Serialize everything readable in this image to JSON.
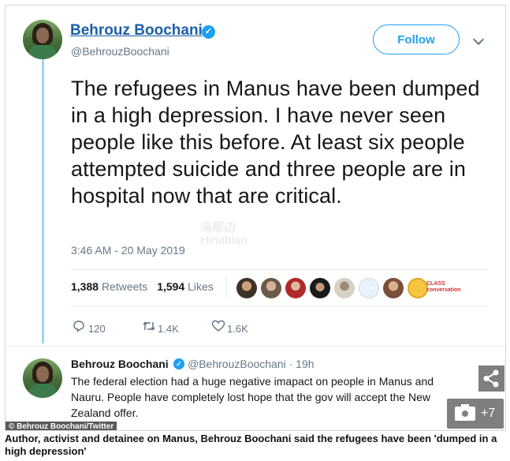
{
  "tweet": {
    "author_name": "Behrouz Boochani",
    "verified_mark": "✓",
    "handle": "@BehrouzBoochani",
    "follow_label": "Follow",
    "text": "The refugees in Manus have been dumped in a high depression. I have never seen people like this before. At least six people attempted suicide and three people are in hospital now that are critical.",
    "timestamp": "3:46 AM - 20 May 2019",
    "retweets_count": "1,388",
    "retweets_label": "Retweets",
    "likes_count": "1,594",
    "likes_label": "Likes",
    "liker_last_label": "CLASS conversation",
    "actions": {
      "reply_count": "120",
      "retweet_count": "1.4K",
      "like_count": "1.6K"
    },
    "icons": {
      "reply": "reply-icon",
      "retweet": "retweet-icon",
      "like": "heart-icon",
      "chevron": "chevron-down-icon",
      "verified": "verified-badge-icon"
    }
  },
  "watermark": {
    "line1": "海那边",
    "line2": "Hinabian"
  },
  "reply": {
    "author_name": "Behrouz Boochani",
    "handle_time": "@BehrouzBoochani · 19h",
    "text": "The federal election had a huge negative imapact on people in Manus and Nauru. People have completely lost hope that the gov will accept the New Zealand offer."
  },
  "overlay": {
    "credit": "© Behrouz Boochani/Twitter",
    "gallery_count": "+7",
    "icons": [
      "share-icon",
      "camera-icon"
    ]
  },
  "caption": "Author, activist and detainee on Manus, Behrouz Boochani said the refugees have been 'dumped in a high depression'",
  "colors": {
    "link_blue": "#1b5ea8",
    "twitter_blue": "#1da1f2",
    "thread_line": "#a5d4f3",
    "muted": "#657786"
  }
}
